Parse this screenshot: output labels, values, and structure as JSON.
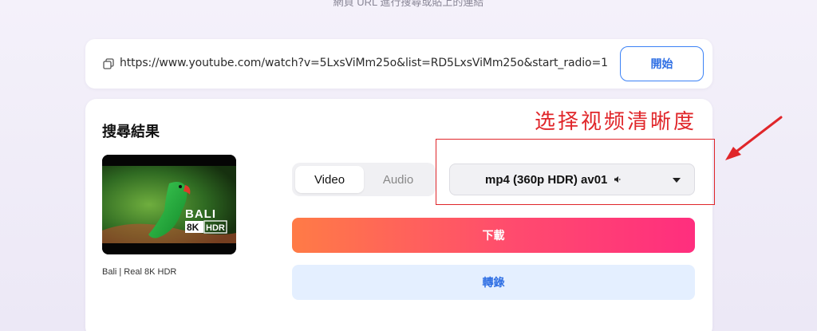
{
  "header": {
    "note": "網頁 URL 進行搜尋或貼上的連結"
  },
  "url_bar": {
    "value": "https://www.youtube.com/watch?v=5LxsViMm25o&list=RD5LxsViMm25o&start_radio=1",
    "start_label": "開始"
  },
  "result": {
    "title": "搜尋結果",
    "video_title": "Bali | Real 8K HDR",
    "thumb_text_main": "BALI",
    "thumb_text_8k": "8K",
    "thumb_text_hdr": "HDR",
    "tabs": [
      {
        "label": "Video",
        "active": true
      },
      {
        "label": "Audio",
        "active": false
      }
    ],
    "format_selected": "mp4 (360p HDR) av01",
    "download_label": "下載",
    "convert_label": "轉錄"
  },
  "annotation": {
    "text": "选择视频清晰度",
    "color": "#e0262a"
  },
  "colors": {
    "accent_blue": "#2f6fe4",
    "download_gradient_start": "#ff7b46",
    "download_gradient_end": "#ff2e7e",
    "convert_bg": "#e4efff"
  }
}
